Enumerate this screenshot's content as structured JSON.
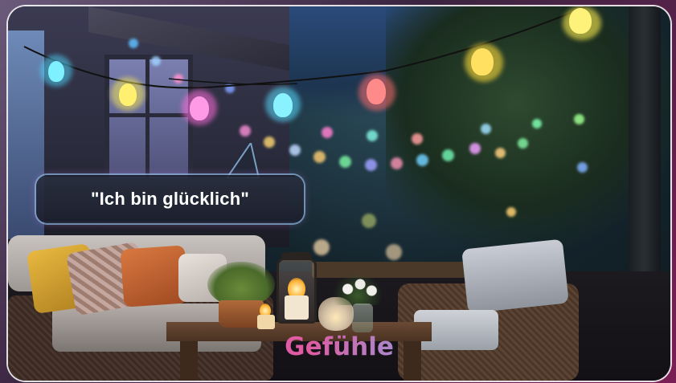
{
  "speech_bubble": {
    "text": "\"Ich bin glücklich\""
  },
  "caption": {
    "text": "Gefühle"
  },
  "scene": {
    "description_colors": {
      "caption_gradient": [
        "#f2a248",
        "#d86ac8",
        "#e05aa0",
        "#7ab0f0",
        "#6ad0e8"
      ],
      "bubble_border": "#8cbee6",
      "card_border": "#ffffff"
    }
  }
}
